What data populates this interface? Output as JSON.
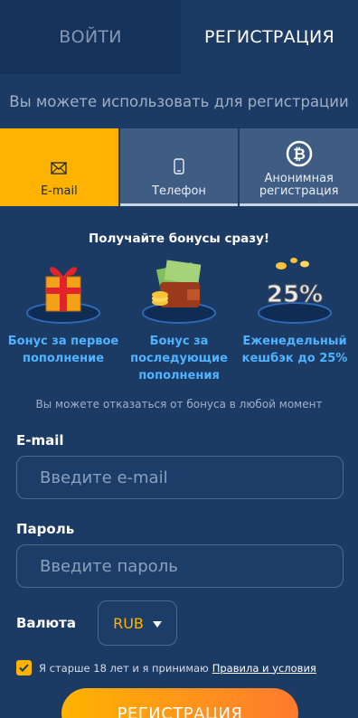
{
  "tabs": {
    "login": "ВОЙТИ",
    "register": "РЕГИСТРАЦИЯ"
  },
  "subtitle": "Вы можете использовать для регистрации",
  "methods": [
    {
      "label": "E-mail",
      "icon": "envelope-icon"
    },
    {
      "label": "Телефон",
      "icon": "phone-icon"
    },
    {
      "label": "Анонимная регистрация",
      "icon": "bitcoin-icon"
    }
  ],
  "bonus": {
    "title": "Получайте бонусы сразу!",
    "items": [
      {
        "caption": "Бонус за первое пополнение",
        "icon": "gift-icon"
      },
      {
        "caption": "Бонус за последующие пополнения",
        "icon": "wallet-money-icon"
      },
      {
        "caption": "Еженедельный кешбэк до 25%",
        "icon": "cashback-25-icon",
        "badge": "25%"
      }
    ],
    "optout": "Вы можете отказаться от бонуса в любой момент"
  },
  "form": {
    "email_label": "E-mail",
    "email_placeholder": "Введите e-mail",
    "password_label": "Пароль",
    "password_placeholder": "Введите пароль",
    "currency_label": "Валюта",
    "currency_value": "RUB",
    "agree_text": "Я старше 18 лет и я принимаю",
    "terms_link": "Правила и условия",
    "submit": "РЕГИСТРАЦИЯ"
  },
  "colors": {
    "background": "#1b3a64",
    "accent": "#ffb300",
    "link": "#4fb3ff"
  }
}
